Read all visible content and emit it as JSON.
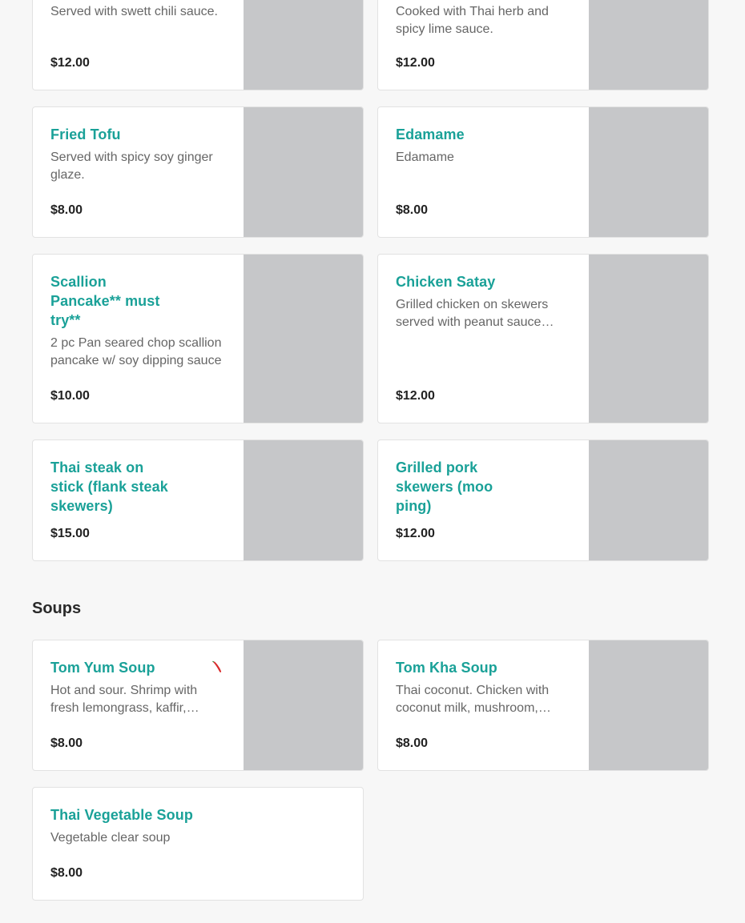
{
  "items": [
    {
      "name": "",
      "description": "Served with swett chili sauce.",
      "price": "$12.00"
    },
    {
      "name": "",
      "description": "Cooked with Thai herb and spicy lime sauce.",
      "price": "$12.00"
    },
    {
      "name": "Fried Tofu",
      "description": "Served with spicy soy ginger glaze.",
      "price": "$8.00"
    },
    {
      "name": "Edamame",
      "description": "Edamame",
      "price": "$8.00"
    },
    {
      "name": "Scallion Pancake** must try**",
      "description": "2 pc Pan seared chop scallion pancake w/ soy dipping sauce",
      "price": "$10.00"
    },
    {
      "name": "Chicken Satay",
      "description": "Grilled chicken on skewers served with peanut sauce an…",
      "price": "$12.00"
    },
    {
      "name": "Thai steak on stick (flank steak skewers)",
      "price": "$15.00"
    },
    {
      "name": "Grilled pork skewers (moo ping)",
      "price": "$12.00"
    }
  ],
  "soups": {
    "title": "Soups",
    "items": [
      {
        "name": "Tom Yum Soup",
        "description": "Hot and sour. Shrimp with fresh lemongrass, kaffir, lime…",
        "price": "$8.00",
        "icon": "chili-pepper-icon"
      },
      {
        "name": "Tom Kha Soup",
        "description": "Thai coconut. Chicken with coconut milk, mushroom,…",
        "price": "$8.00"
      },
      {
        "name": "Thai Vegetable Soup",
        "description": "Vegetable clear soup",
        "price": "$8.00"
      }
    ]
  },
  "colors": {
    "accent": "#1aa198",
    "placeholder": "#c6c7c9",
    "background": "#f7f7f7",
    "chili": "#d92b2b"
  }
}
